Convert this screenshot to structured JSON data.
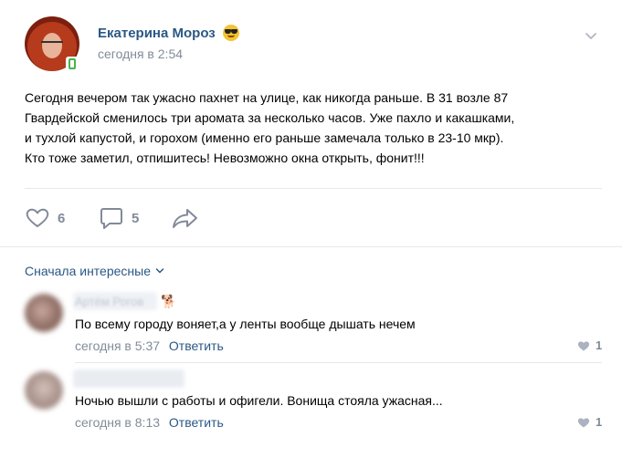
{
  "post": {
    "author": "Екатерина Мороз",
    "author_emoji": "sunglasses-emoji",
    "time": "сегодня в 2:54",
    "text_lines": [
      "Сегодня вечером так ужасно пахнет на улице, как никогда раньше. В 31 возле 87",
      "Гвардейской сменилось три аромата за несколько часов. Уже пахло и какашками,",
      "и тухлой капустой, и горохом (именно его раньше замечала только в 23-10 мкр).",
      "Кто тоже заметил, отпишитесь! Невозможно окна открыть, фонит!!!"
    ],
    "likes": "6",
    "comments": "5"
  },
  "comments_sort": "Сначала интересные",
  "comments": [
    {
      "author": "Артём Рогов",
      "text": "По всему городу воняет,а у ленты вообще дышать нечем",
      "time": "сегодня в 5:37",
      "reply": "Ответить",
      "likes": "1"
    },
    {
      "author": "",
      "text": "Ночью вышли с работы и офигели. Вонища стояла ужасная...",
      "time": "сегодня в 8:13",
      "reply": "Ответить",
      "likes": "1"
    }
  ],
  "colors": {
    "link": "#2a5885",
    "meta": "#818c99",
    "icon": "#828a99",
    "divider": "#e7e8ec"
  }
}
